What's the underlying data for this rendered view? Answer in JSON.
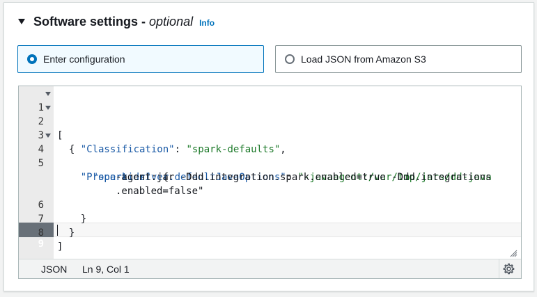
{
  "section": {
    "title": "Software settings",
    "separator": "-",
    "optional_label": "optional",
    "info_label": "Info"
  },
  "tiles": [
    {
      "label": "Enter configuration",
      "selected": true
    },
    {
      "label": "Load JSON from Amazon S3",
      "selected": false
    }
  ],
  "editor": {
    "line_numbers": [
      "1",
      "2",
      "3",
      "4",
      "5",
      "6",
      "7",
      "8",
      "9"
    ],
    "lines": {
      "l1": "[",
      "l2": "  {",
      "l3_key": "\"Classification\"",
      "l3_sep": ": ",
      "l3_val": "\"spark-defaults\"",
      "l3_end": ",",
      "l4_key": "\"Properties\"",
      "l4_rest": ": {",
      "l5_key": "\"spark.driver.defaultJavaOptions\"",
      "l5_sep": ": ",
      "l5_val_a": "\"-javaagent:/var/tmp/jars/dd-java",
      "l5_val_b": "-agent.jar -Ddd.integration.spark.enabled=true -Ddd.integrations",
      "l5_val_c": ".enabled=false\"",
      "l6": "    }",
      "l7": "  }",
      "l8": "]",
      "l9": ""
    },
    "cursor_line": 9,
    "colors": {
      "key": "#1a5aa6",
      "string": "#1d7a2a",
      "gutter": "#ebebeb",
      "active_gutter": "#687078"
    }
  },
  "status_bar": {
    "language": "JSON",
    "position": "Ln 9, Col 1"
  },
  "icons": [
    "caret-down-icon",
    "radio-selected-icon",
    "radio-unselected-icon",
    "fold-arrow-icon",
    "resize-handle-icon",
    "gear-icon"
  ],
  "accent": "#0073bb"
}
